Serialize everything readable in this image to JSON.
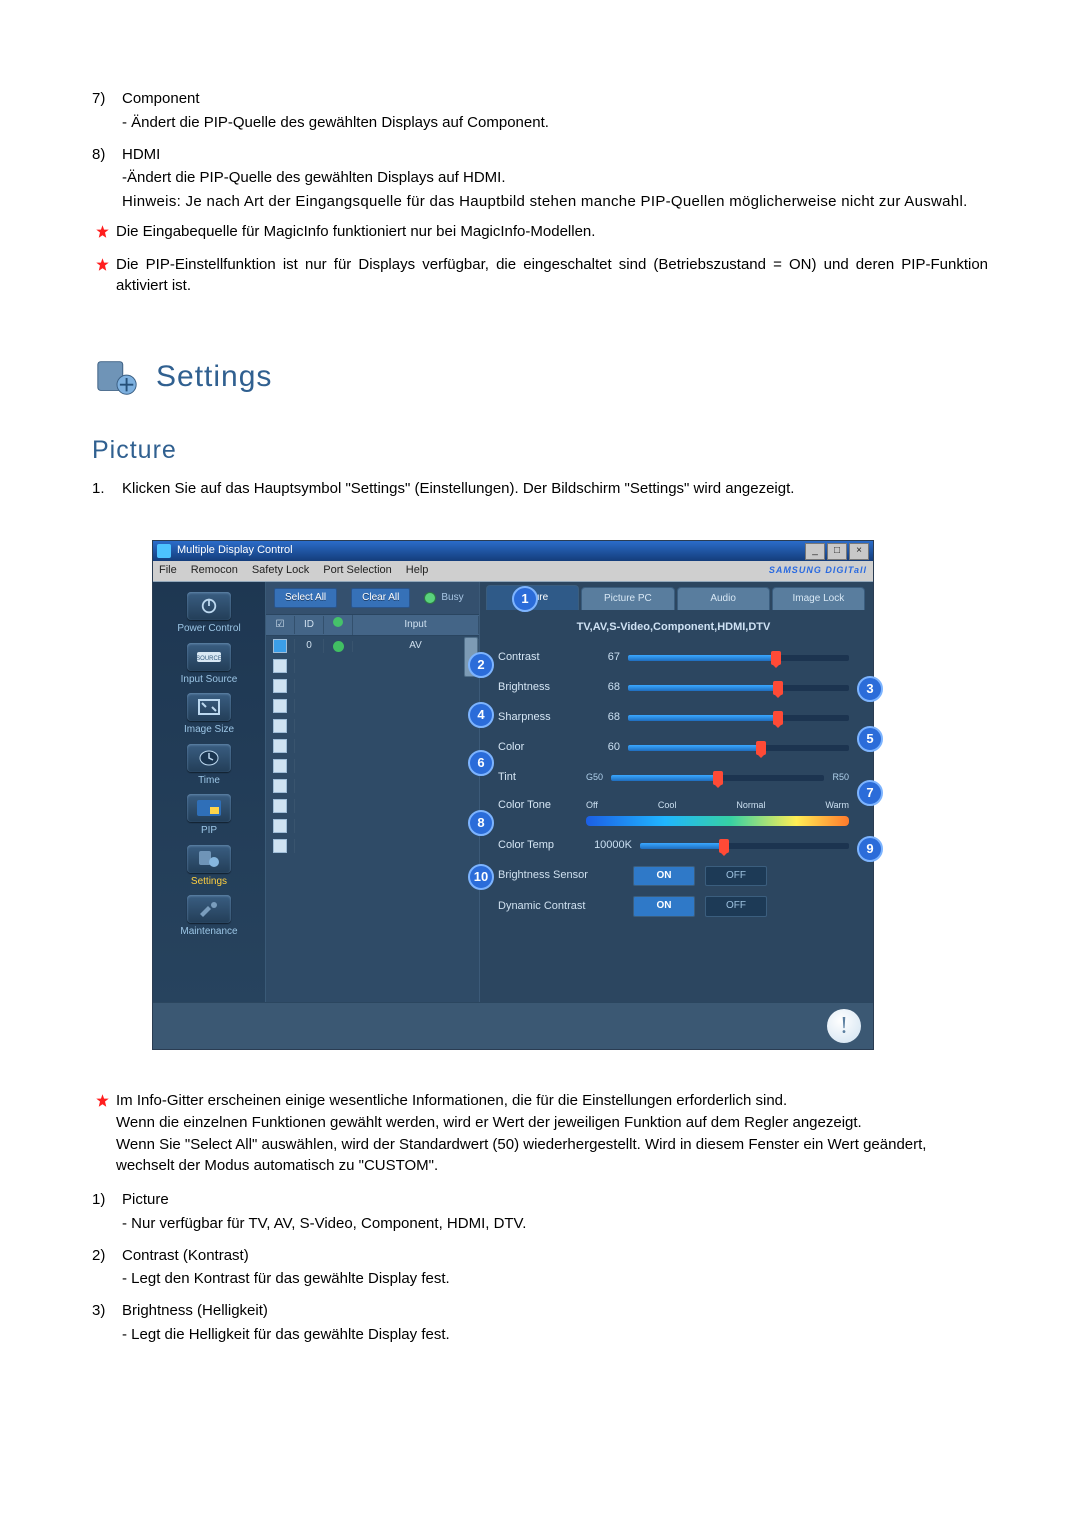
{
  "top_items": [
    {
      "num": "7)",
      "title": "Component",
      "lines": [
        "- Ändert die PIP-Quelle des gewählten Displays auf Component."
      ]
    },
    {
      "num": "8)",
      "title": "HDMI",
      "lines": [
        "-Ändert die PIP-Quelle des gewählten Displays auf HDMI.",
        "Hinweis: Je nach Art der Eingangsquelle für das Hauptbild stehen manche PIP-Quellen möglicherweise nicht zur Auswahl."
      ]
    }
  ],
  "top_starred": [
    "Die Eingabequelle für MagicInfo funktioniert nur bei MagicInfo-Modellen.",
    "Die PIP-Einstellfunktion ist nur für Displays verfügbar, die eingeschaltet sind (Betriebszustand = ON) und deren PIP-Funktion aktiviert ist."
  ],
  "settings_heading": "Settings",
  "picture_heading": "Picture",
  "picture_intro_num": "1.",
  "picture_intro": "Klicken Sie auf das Hauptsymbol \"Settings\" (Einstellungen). Der Bildschirm \"Settings\" wird angezeigt.",
  "mdc": {
    "title": "Multiple Display Control",
    "menubar": [
      "File",
      "Remocon",
      "Safety Lock",
      "Port Selection",
      "Help"
    ],
    "brand": "SAMSUNG DIGITall",
    "sidebar": [
      {
        "label": "Power Control"
      },
      {
        "label": "Input Source"
      },
      {
        "label": "Image Size"
      },
      {
        "label": "Time"
      },
      {
        "label": "PIP"
      },
      {
        "label": "Settings",
        "active": true
      },
      {
        "label": "Maintenance"
      }
    ],
    "toolbar": {
      "select_all": "Select All",
      "clear_all": "Clear All",
      "busy": "Busy"
    },
    "list": {
      "head": {
        "chk": "☑",
        "id": "ID",
        "st": "●",
        "input": "Input"
      },
      "rows": [
        {
          "checked": true,
          "id": "0",
          "status": true,
          "input": "AV"
        }
      ],
      "empty_rows": 10
    },
    "tabs": [
      "Picture",
      "Picture PC",
      "Audio",
      "Image Lock"
    ],
    "active_tab": 0,
    "panel_head": "TV,AV,S-Video,Component,HDMI,DTV",
    "controls": {
      "contrast": {
        "label": "Contrast",
        "value": "67",
        "pct": 67
      },
      "brightness": {
        "label": "Brightness",
        "value": "68",
        "pct": 68
      },
      "sharpness": {
        "label": "Sharpness",
        "value": "68",
        "pct": 68
      },
      "color": {
        "label": "Color",
        "value": "60",
        "pct": 60
      },
      "tint": {
        "label": "Tint",
        "left": "G50",
        "right": "R50",
        "pct": 50
      },
      "color_tone": {
        "label": "Color Tone",
        "marks": [
          "Off",
          "Cool",
          "Normal",
          "Warm"
        ],
        "sel_pct": 60
      },
      "color_temp": {
        "label": "Color Temp",
        "value": "10000K",
        "pct": 40
      },
      "bright_sensor": {
        "label": "Brightness Sensor",
        "on": "ON",
        "off": "OFF",
        "state": "on"
      },
      "dyn_contrast": {
        "label": "Dynamic Contrast",
        "on": "ON",
        "off": "OFF",
        "state": "on"
      }
    },
    "callouts": [
      "1",
      "2",
      "3",
      "4",
      "5",
      "6",
      "7",
      "8",
      "9",
      "10"
    ]
  },
  "bottom_starred": "Im Info-Gitter erscheinen einige wesentliche Informationen, die für die Einstellungen erforderlich sind.\nWenn die einzelnen Funktionen gewählt werden, wird er Wert der jeweiligen Funktion auf dem Regler angezeigt.\nWenn Sie \"Select All\" auswählen, wird der Standardwert (50) wiederhergestellt. Wird in diesem Fenster ein Wert geändert, wechselt der Modus automatisch zu \"CUSTOM\".",
  "bottom_items": [
    {
      "num": "1)",
      "title": "Picture",
      "lines": [
        "- Nur verfügbar für TV, AV, S-Video, Component, HDMI, DTV."
      ]
    },
    {
      "num": "2)",
      "title": "Contrast (Kontrast)",
      "lines": [
        "- Legt den Kontrast für das gewählte Display fest."
      ]
    },
    {
      "num": "3)",
      "title": "Brightness (Helligkeit)",
      "lines": [
        "- Legt die Helligkeit für das gewählte Display fest."
      ]
    }
  ]
}
